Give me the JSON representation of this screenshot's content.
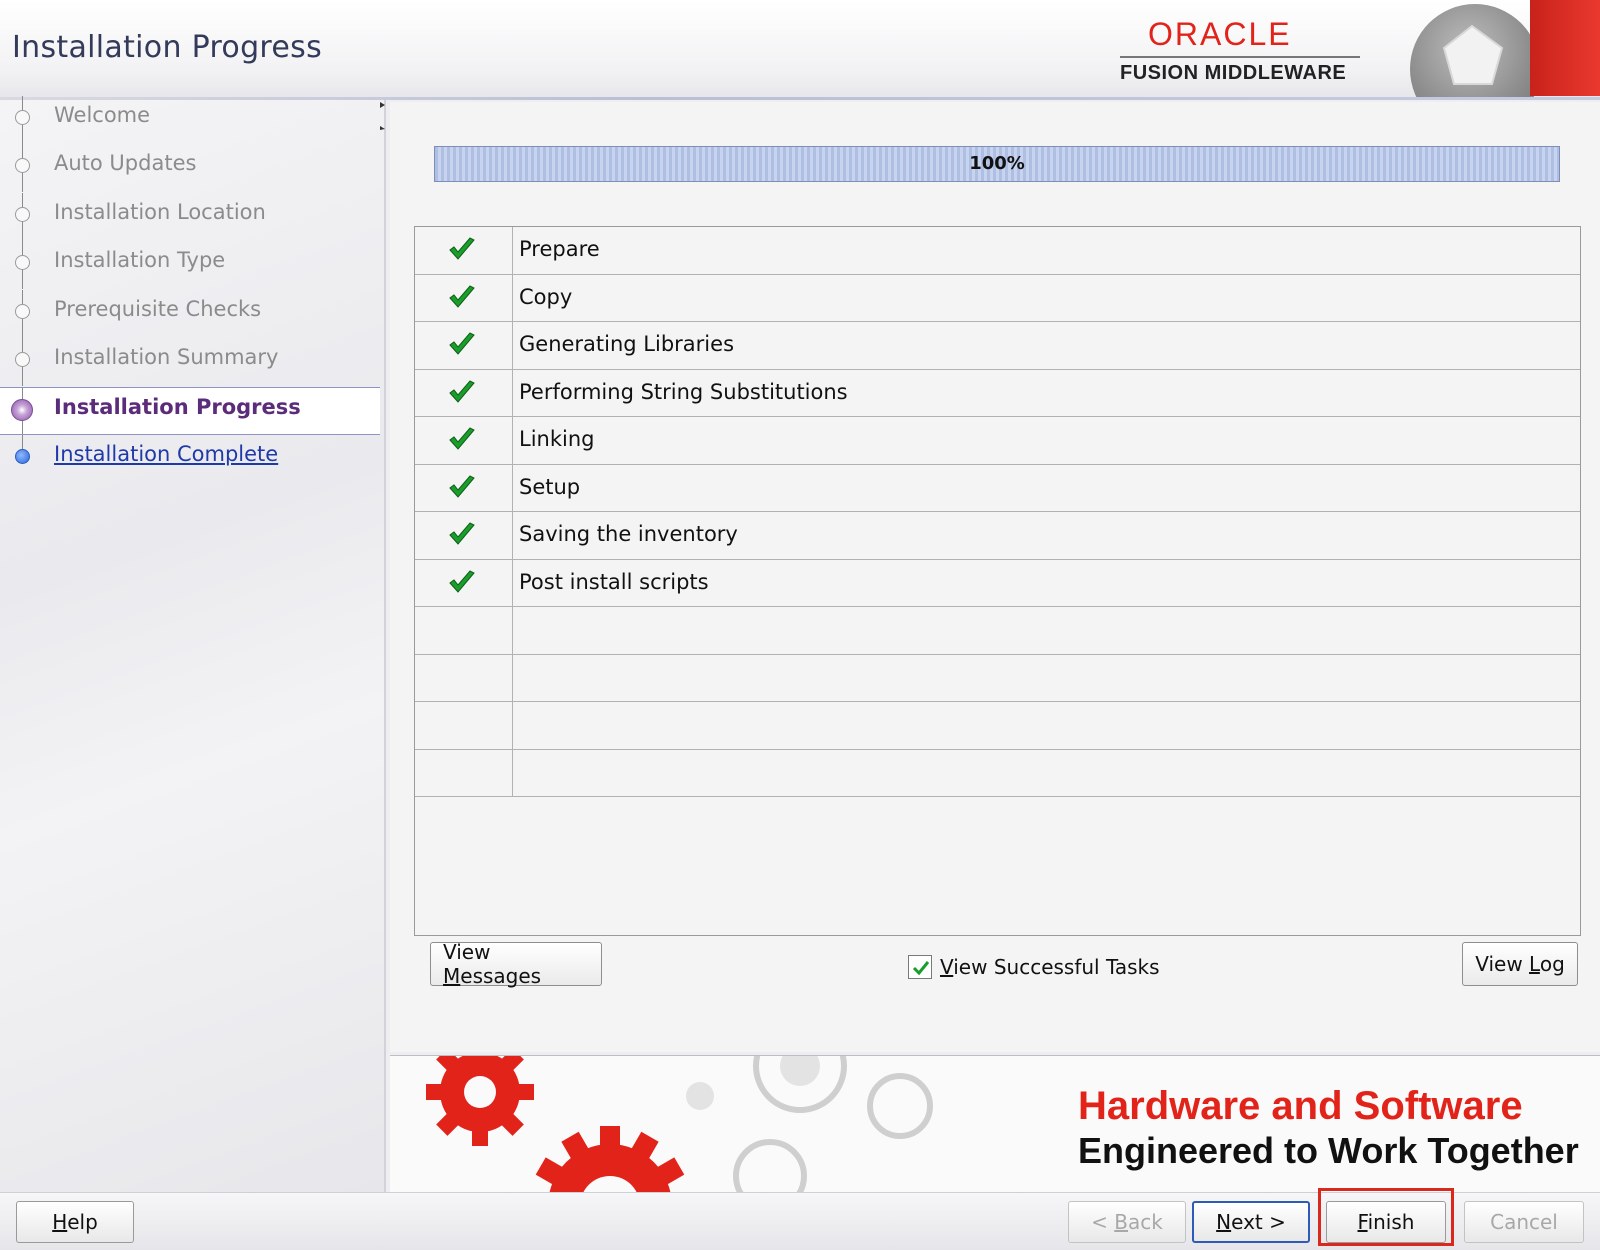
{
  "header": {
    "title": "Installation Progress",
    "logo_brand": "ORACLE",
    "logo_product": "FUSION MIDDLEWARE"
  },
  "sidebar": {
    "steps": [
      {
        "label": "Welcome",
        "state": "done"
      },
      {
        "label": "Auto Updates",
        "state": "done"
      },
      {
        "label": "Installation Location",
        "state": "done"
      },
      {
        "label": "Installation Type",
        "state": "done"
      },
      {
        "label": "Prerequisite Checks",
        "state": "done"
      },
      {
        "label": "Installation Summary",
        "state": "done"
      },
      {
        "label": "Installation Progress",
        "state": "current"
      },
      {
        "label": "Installation Complete",
        "state": "next"
      }
    ]
  },
  "progress": {
    "percent_label": "100%",
    "fraction": 1.0
  },
  "tasks": {
    "rows": [
      {
        "label": "Prepare",
        "status": "check-icon"
      },
      {
        "label": "Copy",
        "status": "check-icon"
      },
      {
        "label": "Generating Libraries",
        "status": "check-icon"
      },
      {
        "label": "Performing String Substitutions",
        "status": "check-icon"
      },
      {
        "label": "Linking",
        "status": "check-icon"
      },
      {
        "label": "Setup",
        "status": "check-icon"
      },
      {
        "label": "Saving the inventory",
        "status": "check-icon"
      },
      {
        "label": "Post install scripts",
        "status": "check-icon"
      },
      {
        "label": "",
        "status": ""
      },
      {
        "label": "",
        "status": ""
      },
      {
        "label": "",
        "status": ""
      },
      {
        "label": "",
        "status": ""
      }
    ]
  },
  "actions": {
    "view_messages_pre": "View ",
    "view_messages_u": "M",
    "view_messages_post": "essages",
    "view_successful_u": "V",
    "view_successful_post": "iew Successful Tasks",
    "view_successful_checked": true,
    "view_log_pre": "View ",
    "view_log_u": "L",
    "view_log_post": "og"
  },
  "banner": {
    "line1": "Hardware and Software",
    "line2": "Engineered to Work Together"
  },
  "footer": {
    "help_u": "H",
    "help_post": "elp",
    "back_pre": "< ",
    "back_u": "B",
    "back_post": "ack",
    "next_u": "N",
    "next_post": "ext >",
    "finish_u": "F",
    "finish_post": "inish",
    "cancel": "Cancel"
  },
  "colors": {
    "oracle_red": "#e2231a",
    "current_step": "#5b2c7a",
    "link_blue": "#1e3aa8",
    "check_green": "#1a9e2a"
  }
}
